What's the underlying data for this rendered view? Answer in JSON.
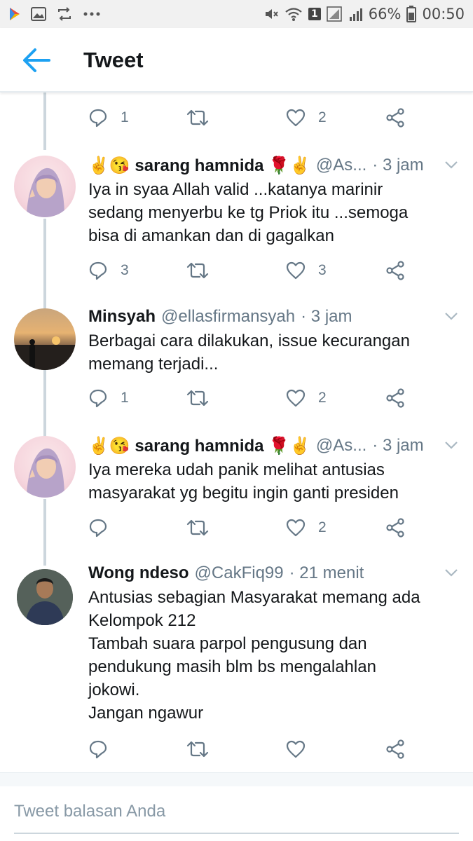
{
  "status_bar": {
    "battery": "66%",
    "time": "00:50",
    "sim_badge": "1"
  },
  "app_bar": {
    "title": "Tweet"
  },
  "top_actions": {
    "reply_count": "1",
    "retweet_count": "",
    "like_count": "2"
  },
  "tweets": [
    {
      "name": "✌😘 sarang hamnida 🌹✌",
      "handle": "@As...",
      "time": "· 3 jam",
      "text": "Iya in syaa Allah valid ...katanya marinir\nsedang menyerbu ke tg Priok itu ...semoga\nbisa di amankan dan di gagalkan",
      "reply_count": "3",
      "like_count": "3"
    },
    {
      "name": "Minsyah",
      "handle": "@ellasfirmansyah",
      "time": "· 3 jam",
      "text": "Berbagai cara dilakukan, issue kecurangan\nmemang terjadi...",
      "reply_count": "1",
      "like_count": "2"
    },
    {
      "name": "✌😘 sarang hamnida 🌹✌",
      "handle": "@As...",
      "time": "· 3 jam",
      "text": "Iya mereka udah panik melihat antusias\nmasyarakat yg begitu ingin ganti presiden",
      "reply_count": "",
      "like_count": "2"
    },
    {
      "name": "Wong ndeso",
      "handle": "@CakFiq99",
      "time": "· 21 menit",
      "text": "Antusias sebagian Masyarakat memang ada\nKelompok 212\nTambah suara parpol pengusung dan\npendukung masih blm bs mengalahlan\njokowi.\nJangan ngawur",
      "reply_count": "",
      "like_count": ""
    }
  ],
  "reply_box": {
    "placeholder": "Tweet balasan Anda"
  },
  "colors": {
    "accent": "#1da1f2",
    "icon_gray": "#657786",
    "thread_line": "#ccd6dd"
  }
}
